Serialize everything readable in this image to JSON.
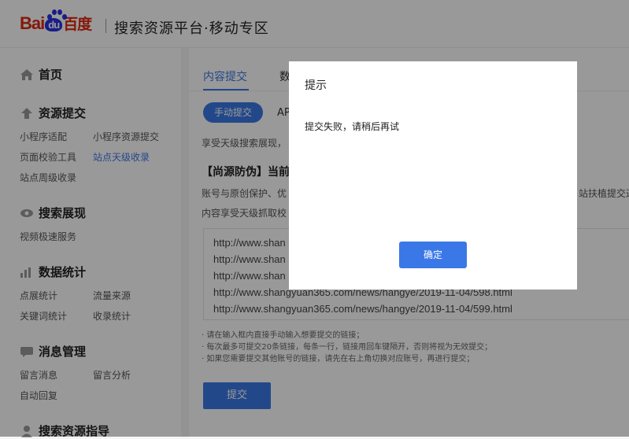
{
  "header": {
    "logo_left": "Bai",
    "logo_du": "du",
    "logo_right": "百度",
    "platform_title": "搜索资源平台·移动专区"
  },
  "sidebar": {
    "home": "首页",
    "resource_submit": {
      "title": "资源提交",
      "items": [
        "小程序适配",
        "小程序资源提交",
        "页面校验工具",
        "站点天级收录",
        "站点周级收录"
      ]
    },
    "search_display": {
      "title": "搜索展现",
      "items": [
        "视频极速服务"
      ]
    },
    "data_stats": {
      "title": "数据统计",
      "items": [
        "点展统计",
        "流量来源",
        "关键词统计",
        "收录统计"
      ]
    },
    "message_mgmt": {
      "title": "消息管理",
      "items": [
        "留言消息",
        "留言分析",
        "自动回复"
      ]
    },
    "guide": {
      "title": "搜索资源指导"
    }
  },
  "main": {
    "tabs": [
      "内容提交",
      "数"
    ],
    "pills": [
      "手动提交",
      "AP"
    ],
    "intro": "享受天级搜索展现，",
    "section_title": "【尚源防伪】当前天",
    "desc1": "账号与原创保护、优",
    "desc1_right": "站扶植提交过",
    "desc2": "内容享受天级抓取校",
    "urls": [
      "http://www.shan",
      "http://www.shan",
      "http://www.shan",
      "http://www.shangyuan365.com/news/hangye/2019-11-04/598.html",
      "http://www.shangyuan365.com/news/hangye/2019-11-04/599.html"
    ],
    "notes": [
      "· 请在输入框内直接手动输入想要提交的链接；",
      "· 每次最多可提交20条链接，每条一行，链接用回车键隔开，否则将视为无效提交；",
      "· 如果您需要提交其他账号的链接，请先在右上角切换对应账号，再进行提交；"
    ],
    "submit_label": "提交"
  },
  "dialog": {
    "title": "提示",
    "message": "提交失败，请稍后再试",
    "ok_label": "确定"
  }
}
